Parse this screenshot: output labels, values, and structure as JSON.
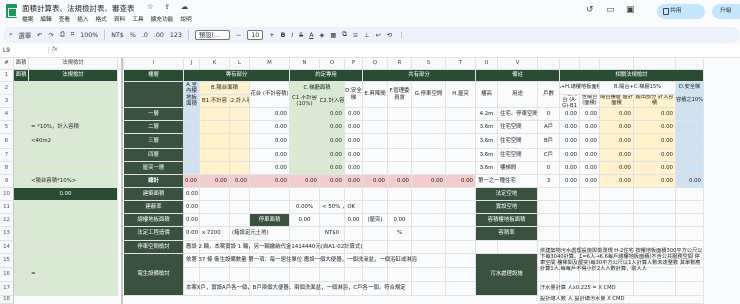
{
  "title": "面積計算表、法規檢討表、審查表",
  "menu": [
    "檔案",
    "編輯",
    "查看",
    "插入",
    "格式",
    "資料",
    "工具",
    "擴充功能",
    "說明"
  ],
  "share": "共用",
  "upgrade": "升級",
  "toolbar": {
    "search": "選單",
    "zoom": "100%",
    "currency": "NT$",
    "percent": "%",
    "decimal1": ".0",
    "decimal2": ".00",
    "format": "123",
    "font": "預設(...",
    "size": "10"
  },
  "cell_ref": "L9",
  "fx": "fx",
  "col_headers": [
    "#",
    "面積",
    "法規檢討",
    "",
    "I",
    "J",
    "K",
    "L",
    "M",
    "N",
    "O",
    "P",
    "Q",
    "R",
    "S",
    "T",
    "U",
    "V"
  ],
  "row_headers": [
    "1",
    "2",
    "3",
    "4",
    "5",
    "6",
    "7",
    "8",
    "9",
    "10",
    "11",
    "12",
    "13",
    "14",
    "15",
    "16",
    "17",
    "18",
    "19",
    "20",
    "21"
  ],
  "left": {
    "row1_b": "面積",
    "row1_c": "法規檢討",
    "r5": "= *10%，計入容積",
    "r6": "<40m2",
    "r9": "<陽台容積*10%>",
    "r10": "0.00",
    "r16": "= "
  },
  "main": {
    "h1_floor": "樓層",
    "h1_dedicated": "專有部分",
    "h1_agreed": "約定專用",
    "h1_common": "共有部分",
    "h1_remark": "備註",
    "h1_regs": "相關法規檢討",
    "h2_a": "A.室內樓地板面積",
    "h2_b": "B.陽台面積",
    "h2_flower": "花台\n(不計容積)",
    "h2_c": "C.梯廳面積",
    "h2_d": "D.安全梯",
    "h2_e": "E.昇降間",
    "h2_f": "F.管理委員會",
    "h2_g": "G.停車空間",
    "h2_h": "H.屋突",
    "h2_h2": "樓高",
    "h2_use": "用途",
    "h2_hh": "戶數",
    "h2_ahb": "A+H.總樓地板面積",
    "h2_b15": "B.陽台+C.梯廳15%",
    "h3_b1": "B1.不計容",
    "h3_b2": "B2.計入容",
    "h3_c1": "C1.不計容\n(10%)",
    "h3_c2": "C2.計入容",
    "h3_uncount": "不含陽台\n(A-G)-B1",
    "h3_incl": "含陽台\n(面積)",
    "h3_balcony": "陽台樓層\n留計面積",
    "h3_exceed": "超出部分\n計入容積",
    "h3_vol": "容積之10%",
    "floors": [
      {
        "name": "一層",
        "a": "",
        "h": "4.2m",
        "use": "住宅、停車空間",
        "hh": "0",
        "r": "0.00",
        "s": "0.00"
      },
      {
        "name": "二層",
        "a": "",
        "h": "3.6m",
        "use": "住宅空間",
        "hh": "A戶",
        "r": "0.00",
        "s": "0.00"
      },
      {
        "name": "三層",
        "a": "",
        "h": "3.6m",
        "use": "住宅空間",
        "hh": "B戶",
        "r": "0.00",
        "s": "0.00"
      },
      {
        "name": "四層",
        "a": "",
        "h": "3.6m",
        "use": "住宅空間",
        "hh": "C戶",
        "r": "0.00",
        "s": "0.00"
      },
      {
        "name": "屋突一層",
        "a": "",
        "h": "3.6m",
        "use": "樓梯間",
        "hh": "0",
        "r": "0.00",
        "s": "0.00"
      }
    ],
    "total": "總計",
    "first_class": "第一之一種住宅",
    "hh_total": "3",
    "zero": "0.00",
    "zero_pct": "0.00%",
    "row12": "建築面積",
    "row13": "建蔽率",
    "row14": "總樓地板面積",
    "row15": "法定工程造價",
    "row16": "停車空間檢討",
    "row17": "電生設備檢討",
    "r13_mid": "0.00%",
    "r13_sign": "< 50% ，OK",
    "r14_park": "停車面積",
    "r14_paren": "(屋突)",
    "r15_mult": "x 7200",
    "r15_note": "(箱設定元土地)",
    "r15_ntd": "NT$0",
    "r15_pct": "%",
    "r16_text": "應設 2 輛，本案實設 1 輛，另一輛繳納代金1414440元(自A1-02計算式)",
    "r17_a": "依第 37 條  衛生設備數量 第一項：每一居住單位 應設一個大便器，一個洗澡盆，一個浴缸或淋浴",
    "r17_b": "本案X戶，實設A戶各一個，B戶兩個大便器，兩個洗面盆，一個淋浴，C戶各一個，符合規定",
    "reg_remain_area": "法定空地",
    "reg_actual_area": "實設空地",
    "reg_volume": "容積樓地板面積",
    "reg_vol_rate": "容積率",
    "sewage": "污水處理設施",
    "sewage_text": "依建築物污水處理設施與檢測規 H-2住宅 按樓地板面積300平方公尺以下每3040計算。1=6人→6.6每戶總樓地板面積(不含公共服務空間 停車空間 樓梯間及屋突)每30平方公尺以1人計算人數未達整數 其單數應計算1人,每每戶不得小於2人人數計算，取人人",
    "sewage_b": "汙水量計算 人x0.225 = X CMD",
    "sewage_c": "設計總人數 人 設計總污水量 X CMD"
  }
}
